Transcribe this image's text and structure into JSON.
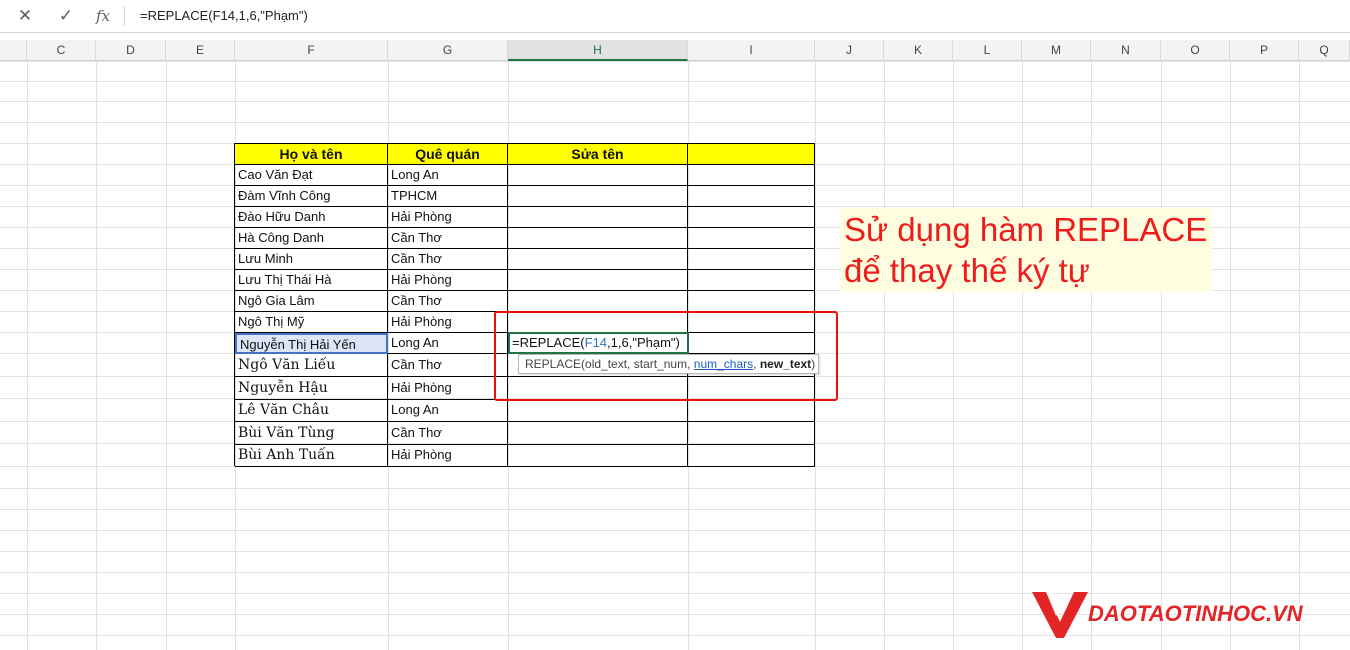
{
  "formula_bar": {
    "cancel_icon": "x-icon",
    "enter_icon": "check-icon",
    "function_icon": "fx-icon",
    "cancel_glyph": "✕",
    "enter_glyph": "✓",
    "fx_glyph": "fx",
    "formula": "=REPLACE(F14,1,6,\"Phạm\")"
  },
  "columns": [
    "C",
    "D",
    "E",
    "F",
    "G",
    "H",
    "I",
    "J",
    "K",
    "L",
    "M",
    "N",
    "O",
    "P",
    "Q"
  ],
  "active_column": "H",
  "table": {
    "headers": [
      "Họ và tên",
      "Quê quán",
      "Sửa tên",
      ""
    ],
    "rows": [
      {
        "name": "Cao Văn Đạt",
        "home": "Long An"
      },
      {
        "name": "Đàm Vĩnh Công",
        "home": "TPHCM"
      },
      {
        "name": "Đào Hữu Danh",
        "home": "Hải Phòng"
      },
      {
        "name": "Hà Công Danh",
        "home": "Cần Thơ"
      },
      {
        "name": "Lưu Minh",
        "home": "Cần Thơ"
      },
      {
        "name": "Lưu Thị Thái Hà",
        "home": "Hải Phòng"
      },
      {
        "name": "Ngô Gia Lâm",
        "home": "Cần Thơ"
      },
      {
        "name": "Ngô Thị Mỹ",
        "home": "Hải Phòng"
      },
      {
        "name": "Nguyễn Thị Hải Yến",
        "home": "Long An"
      },
      {
        "name": "Ngô Văn Liếu",
        "home": "Cần Thơ"
      },
      {
        "name": "Nguyễn Hậu",
        "home": "Hải Phòng"
      },
      {
        "name": "Lê Văn Châu",
        "home": "Long An"
      },
      {
        "name": "Bùi Văn Tùng",
        "home": "Cần Thơ"
      },
      {
        "name": "Bùi Anh Tuấn",
        "home": "Hải Phòng"
      }
    ]
  },
  "editing": {
    "prefix": "=REPLACE(",
    "ref": "F14",
    "suffix": ",1,6,\"Phạm\")"
  },
  "tooltip": {
    "fn": "REPLACE(",
    "arg1": "old_text, start_num, ",
    "arg_current": "num_chars",
    "sep": ", ",
    "arg_bold": "new_text",
    "close": ")"
  },
  "callout": {
    "line1": "Sử dụng hàm REPLACE",
    "line2": "để thay thế ký tự"
  },
  "logo": {
    "text": "DAOTAOTINHOC.VN",
    "color": "#e32526"
  },
  "colors": {
    "header_fill": "#ffff00",
    "excel_green": "#217346",
    "annotation_red": "#e81010"
  }
}
